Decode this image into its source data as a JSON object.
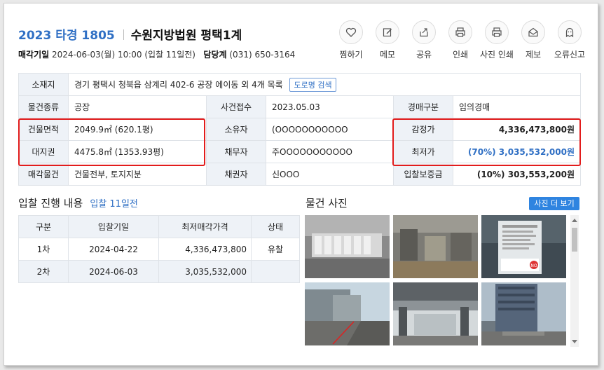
{
  "header": {
    "case_no": "2023 타경 1805",
    "court": "수원지방법원 평택1계",
    "sale_date_label": "매각기일",
    "sale_date_value": "2024-06-03(월) 10:00 (입찰 11일전)",
    "dept_label": "담당계",
    "dept_value": "(031) 650-3164"
  },
  "actions": [
    {
      "label": "찜하기",
      "icon": "heart-icon"
    },
    {
      "label": "메모",
      "icon": "pencil-icon"
    },
    {
      "label": "공유",
      "icon": "share-icon"
    },
    {
      "label": "인쇄",
      "icon": "printer-icon"
    },
    {
      "label": "사진 인쇄",
      "icon": "printer-icon"
    },
    {
      "label": "제보",
      "icon": "envelope-icon"
    },
    {
      "label": "오류신고",
      "icon": "ghost-icon"
    }
  ],
  "info": {
    "location_label": "소재지",
    "location_value": "경기 평택시 청북읍 삼계리 402-6 공장 에이동 외 4개 목록",
    "road_btn": "도로명 검색",
    "type_label": "물건종류",
    "type_value": "공장",
    "case_received_label": "사건접수",
    "case_received_value": "2023.05.03",
    "auction_type_label": "경매구분",
    "auction_type_value": "임의경매",
    "bldg_area_label": "건물면적",
    "bldg_area_value": "2049.9㎡ (620.1평)",
    "owner_label": "소유자",
    "owner_value": "(OOOOOOOOOOO",
    "appraisal_label": "감정가",
    "appraisal_value": "4,336,473,800원",
    "land_label": "대지권",
    "land_value": "4475.8㎡ (1353.93평)",
    "debtor_label": "채무자",
    "debtor_value": "주OOOOOOOOOOO",
    "min_label": "최저가",
    "min_value": "(70%) 3,035,532,000원",
    "sale_item_label": "매각물건",
    "sale_item_value": "건물전부, 토지지분",
    "creditor_label": "채권자",
    "creditor_value": "신OOO",
    "deposit_label": "입찰보증금",
    "deposit_value": "(10%) 303,553,200원"
  },
  "progress": {
    "title": "입찰 진행 내용",
    "sub": "입찰 11일전",
    "headers": [
      "구분",
      "입찰기일",
      "최저매각가격",
      "상태"
    ],
    "rows": [
      [
        "1차",
        "2024-04-22",
        "4,336,473,800",
        "유찰"
      ],
      [
        "2차",
        "2024-06-03",
        "3,035,532,000",
        ""
      ]
    ]
  },
  "photos": {
    "title": "물건 사진",
    "more_btn": "사진 더 보기",
    "sign_text": "NO"
  },
  "colors": {
    "accent": "#2f6fc4",
    "highlight_border": "#e21c1c",
    "header_cell_bg": "#eef2f7"
  }
}
